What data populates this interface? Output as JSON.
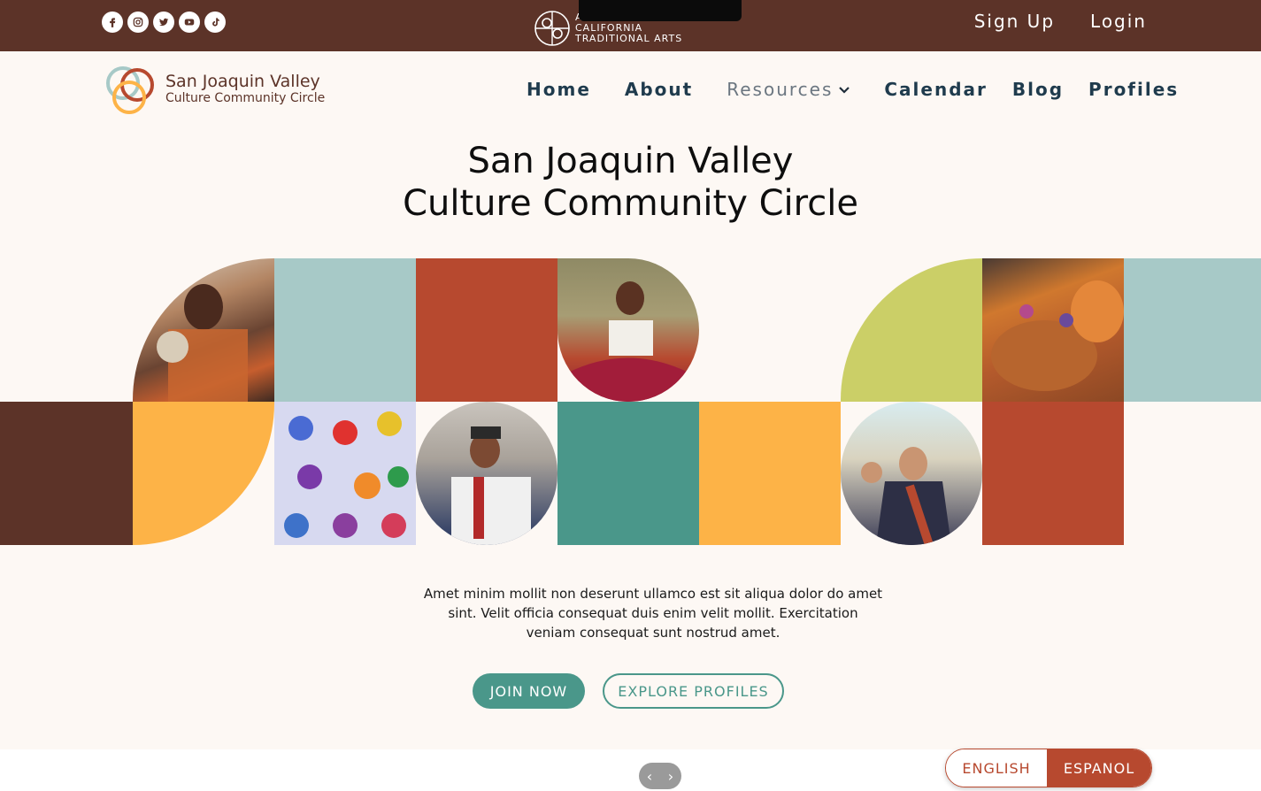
{
  "topbar": {
    "social": [
      "facebook-icon",
      "instagram-icon",
      "twitter-icon",
      "youtube-icon",
      "tiktok-icon"
    ],
    "acta_lines": [
      "ALLIANCE FOR",
      "CALIFORNIA",
      "TRADITIONAL ARTS"
    ],
    "signup_label": "Sign Up",
    "login_label": "Login"
  },
  "logo": {
    "title": "San Joaquin Valley",
    "subtitle": "Culture Community Circle"
  },
  "nav": {
    "home": "Home",
    "about": "About",
    "resources": "Resources",
    "calendar": "Calendar",
    "blog": "Blog",
    "profiles": "Profiles"
  },
  "hero": {
    "title_line1": "San Joaquin Valley",
    "title_line2": "Culture Community Circle",
    "description": "Amet minim mollit non deserunt ullamco est sit aliqua dolor do amet sint. Velit officia consequat duis enim velit mollit. Exercitation veniam consequat sunt nostrud amet.",
    "join_label": "JOIN NOW",
    "explore_label": "EXPLORE PROFILES"
  },
  "lang": {
    "english": "ENGLISH",
    "espanol": "ESPANOL"
  },
  "colors": {
    "brown": "#5c3328",
    "teal": "#4a978a",
    "light_teal": "#a7c9c7",
    "rust": "#b7492f",
    "orange": "#fdb347",
    "lime": "#cbcf67",
    "cream": "#fdf8f4"
  }
}
